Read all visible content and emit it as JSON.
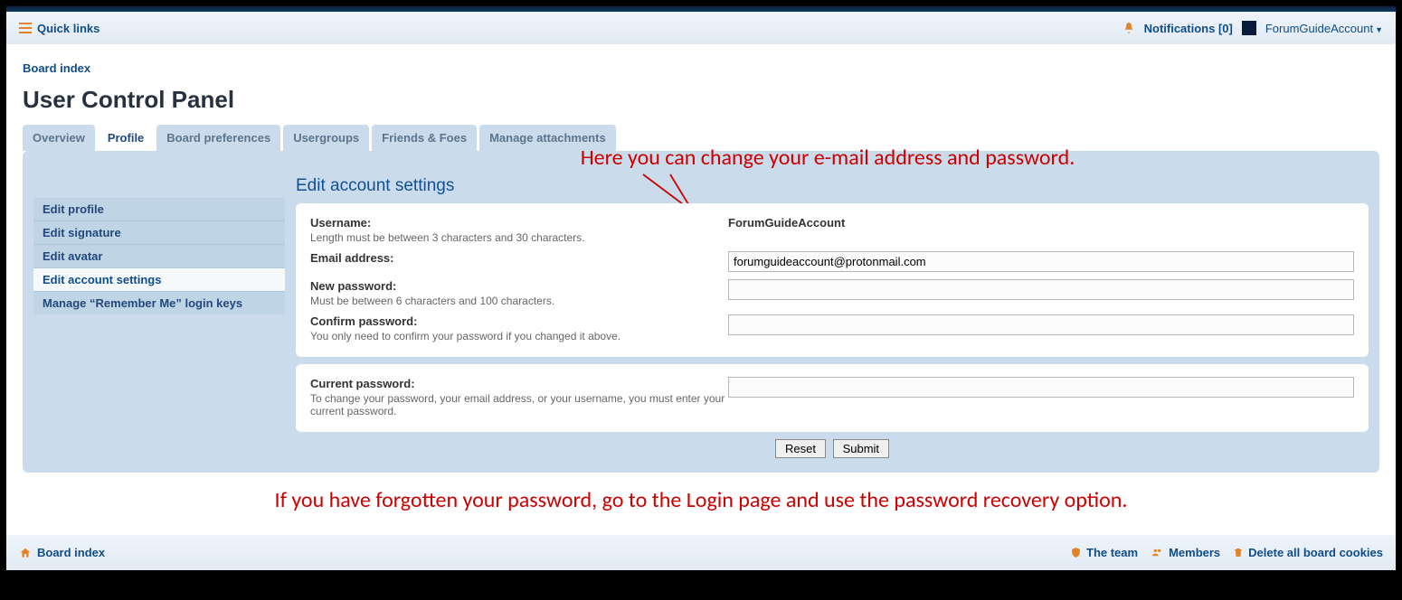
{
  "navbar": {
    "quick_links": "Quick links",
    "notifications": "Notifications [0]",
    "username": "ForumGuideAccount"
  },
  "breadcrumb": {
    "board_index": "Board index"
  },
  "page_title": "User Control Panel",
  "tabs": [
    {
      "label": "Overview"
    },
    {
      "label": "Profile"
    },
    {
      "label": "Board preferences"
    },
    {
      "label": "Usergroups"
    },
    {
      "label": "Friends & Foes"
    },
    {
      "label": "Manage attachments"
    }
  ],
  "sidemenu": [
    {
      "label": "Edit profile"
    },
    {
      "label": "Edit signature"
    },
    {
      "label": "Edit avatar"
    },
    {
      "label": "Edit account settings"
    },
    {
      "label": "Manage “Remember Me” login keys"
    }
  ],
  "section_title": "Edit account settings",
  "form": {
    "username_label": "Username:",
    "username_hint": "Length must be between 3 characters and 30 characters.",
    "username_value": "ForumGuideAccount",
    "email_label": "Email address:",
    "email_value": "forumguideaccount@protonmail.com",
    "new_password_label": "New password:",
    "new_password_hint": "Must be between 6 characters and 100 characters.",
    "confirm_password_label": "Confirm password:",
    "confirm_password_hint": "You only need to confirm your password if you changed it above.",
    "current_password_label": "Current password:",
    "current_password_hint": "To change your password, your email address, or your username, you must enter your current password.",
    "reset": "Reset",
    "submit": "Submit"
  },
  "annotation1": "Here you can change your e-mail address and password.",
  "annotation2": "If you have forgotten your password, go to the Login page and use the password recovery option.",
  "footer": {
    "board_index": "Board index",
    "the_team": "The team",
    "members": "Members",
    "delete_cookies": "Delete all board cookies"
  }
}
